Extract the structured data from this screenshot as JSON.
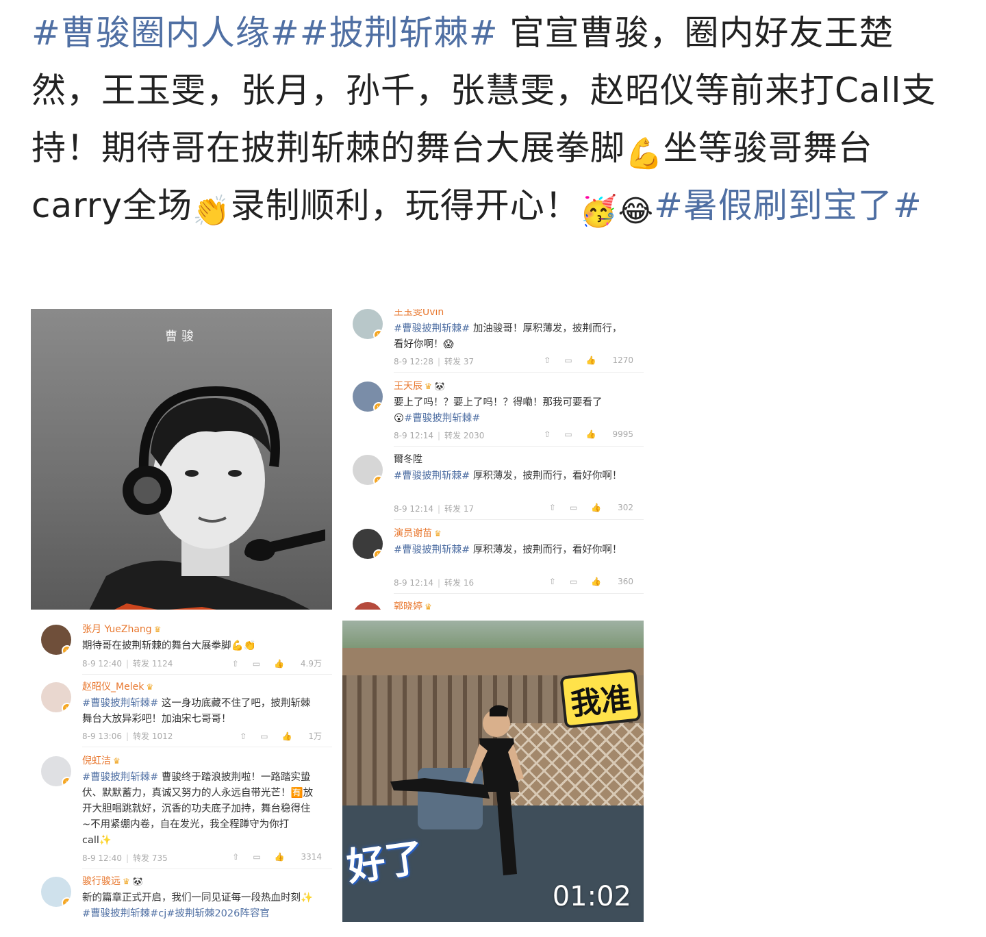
{
  "post": {
    "tag1": "#曹骏圈内人缘#",
    "tag2": "#披荆斩棘#",
    "text1": " 官宣曹骏，圈内好友王楚然，王玉雯，张月，孙千，张慧雯，赵昭仪等前来打Call支持！期待哥在披荆斩棘的舞台大展拳脚",
    "emoji_muscle": "💪",
    "text2": "坐等骏哥舞台carry全场",
    "emoji_clap": "👏",
    "text3": "录制顺利，玩得开心！",
    "emoji_a": "🥳",
    "emoji_b": "😂",
    "tag3": "#暑假刷到宝了#"
  },
  "image1": {
    "title": "曹骏"
  },
  "image2": {
    "comments": [
      {
        "name": "王玉雯Uvin",
        "tag": "#曹骏披荆斩棘#",
        "text": " 加油骏哥！厚积薄发，披荆而行，看好你啊！",
        "emoji": "😱",
        "time": "8-9 12:28",
        "repost": "转发 37",
        "likes": "1270"
      },
      {
        "name": "王天辰",
        "text": "要上了吗！？要上了吗！？得嘞！那我可要看了",
        "emoji": "😮",
        "tag": "#曹骏披荆斩棘#",
        "time": "8-9 12:14",
        "repost": "转发 2030",
        "likes": "9995"
      },
      {
        "name": "爾冬陞",
        "tag": "#曹骏披荆斩棘#",
        "text": " 厚积薄发，披荆而行，看好你啊！",
        "time": "8-9 12:14",
        "repost": "转发 17",
        "likes": "302"
      },
      {
        "name": "演员谢苗",
        "tag": "#曹骏披荆斩棘#",
        "text": " 厚积薄发，披荆而行，看好你啊！",
        "time": "8-9 12:14",
        "repost": "转发 16",
        "likes": "360"
      },
      {
        "name": "郭晓婷"
      }
    ]
  },
  "image3": {
    "comments": [
      {
        "name": "张月 YueZhang",
        "text": "期待哥在披荆斩棘的舞台大展拳脚",
        "emoji": "💪👏",
        "time": "8-9 12:40",
        "repost": "转发 1124",
        "likes": "4.9万"
      },
      {
        "name": "赵昭仪_Melek",
        "tag": "#曹骏披荆斩棘#",
        "text": " 这一身功底藏不住了吧，披荆斩棘舞台大放异彩吧！加油宋七哥哥！",
        "time": "8-9 13:06",
        "repost": "转发 1012",
        "likes": "1万"
      },
      {
        "name": "倪虹洁",
        "tag": "#曹骏披荆斩棘#",
        "text": " 曹骏终于踏浪披荆啦！一路踏实蛰伏、默默蓄力，真诚又努力的人永远自带光芒！",
        "emoji": "🈶",
        "text2": "放开大胆唱跳就好，沉香的功夫底子加持，舞台稳得住~不用紧绷内卷，自在发光，我全程蹲守为你打 call",
        "sparkle": "✨",
        "time": "8-9 12:40",
        "repost": "转发 735",
        "likes": "3314"
      },
      {
        "name": "骏行骏远",
        "text": "新的篇章正式开启，我们一同见证每一段热血时刻",
        "sparkle": "✨",
        "tag": " #曹骏披荆斩棘#cj#披荆斩棘2026阵容官"
      }
    ]
  },
  "image4": {
    "caption_top": "我准",
    "caption_bottom": "好了",
    "duration": "01:02"
  }
}
